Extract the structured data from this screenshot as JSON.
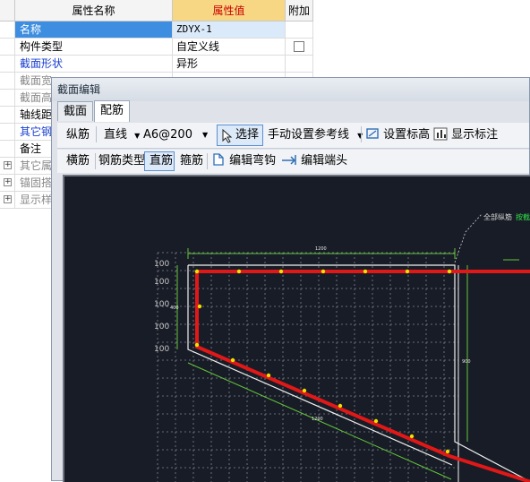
{
  "grid": {
    "headers": {
      "name": "属性名称",
      "value": "属性值",
      "extra": "附加"
    },
    "rows": [
      {
        "name": "名称",
        "value": "ZDYX-1",
        "selected": true
      },
      {
        "name": "构件类型",
        "value": "自定义线",
        "checkbox": true
      },
      {
        "name": "截面形状",
        "value": "异形",
        "link": true
      },
      {
        "name": "截面宽"
      },
      {
        "name": "截面高"
      },
      {
        "name": "轴线距"
      },
      {
        "name": "其它钢",
        "link": true
      },
      {
        "name": "备注"
      },
      {
        "name": "其它属",
        "expand": true
      },
      {
        "name": "锚固搭",
        "expand": true
      },
      {
        "name": "显示样",
        "expand": true
      }
    ]
  },
  "dialog": {
    "title": "截面编辑",
    "tabs": [
      "截面",
      "配筋"
    ],
    "active_tab": "配筋",
    "toolbar1": {
      "rebar_kind": "纵筋",
      "line_mode": "直线",
      "spec": "A6@200",
      "select": "选择",
      "manual_ref": "手动设置参考线",
      "set_elevation": "设置标高",
      "show_dims": "显示标注"
    },
    "toolbar2": {
      "stirrup_kind": "横筋",
      "rebar_type_label": "钢筋类型:",
      "straight": "直筋",
      "hoop": "箍筋",
      "edit_hook": "编辑弯钩",
      "edit_end": "编辑端头"
    }
  },
  "cad": {
    "dims": {
      "top": "1200",
      "left": "400",
      "diagonal": "1200",
      "right": "900"
    },
    "grid_label": "100",
    "annotation": {
      "label": "全部纵筋",
      "value": "按截"
    },
    "colors": {
      "background": "#181c26",
      "section": "#e01818",
      "bars": "#f0e000",
      "dim": "#63c63b",
      "grid": "#7f8490"
    }
  }
}
